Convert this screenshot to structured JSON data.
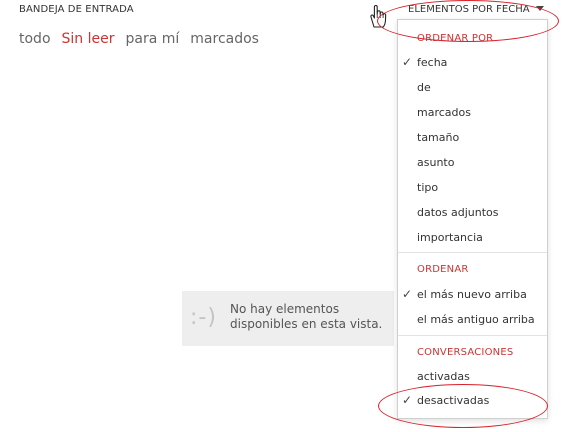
{
  "header": {
    "inbox_title": "BANDEJA DE ENTRADA",
    "sort_label": "ELEMENTOS POR FECHA"
  },
  "filters": [
    {
      "label": "todo",
      "active": false
    },
    {
      "label": "Sin leer",
      "active": true
    },
    {
      "label": "para mí",
      "active": false
    },
    {
      "label": "marcados",
      "active": false
    }
  ],
  "empty_state": {
    "icon_text": ":-)",
    "line1": "No hay elementos",
    "line2": "disponibles en esta vista."
  },
  "dropdown": {
    "sort_by": {
      "header": "ORDENAR POR",
      "items": [
        {
          "label": "fecha",
          "checked": true
        },
        {
          "label": "de",
          "checked": false
        },
        {
          "label": "marcados",
          "checked": false
        },
        {
          "label": "tamaño",
          "checked": false
        },
        {
          "label": "asunto",
          "checked": false
        },
        {
          "label": "tipo",
          "checked": false
        },
        {
          "label": "datos adjuntos",
          "checked": false
        },
        {
          "label": "importancia",
          "checked": false
        }
      ]
    },
    "order": {
      "header": "ORDENAR",
      "items": [
        {
          "label": "el más nuevo arriba",
          "checked": true
        },
        {
          "label": "el más antiguo arriba",
          "checked": false
        }
      ]
    },
    "conversations": {
      "header": "CONVERSACIONES",
      "items": [
        {
          "label": "activadas",
          "checked": false
        },
        {
          "label": "desactivadas",
          "checked": true
        }
      ]
    }
  },
  "colors": {
    "accent": "#cc3333",
    "annotation": "#d8202a",
    "text": "#333333",
    "empty_bg": "#eeeeee"
  },
  "icons": {
    "check": "checkmark-icon",
    "caret": "caret-down-icon",
    "cursor": "hand-pointer-icon",
    "empty": "smiley-icon"
  }
}
